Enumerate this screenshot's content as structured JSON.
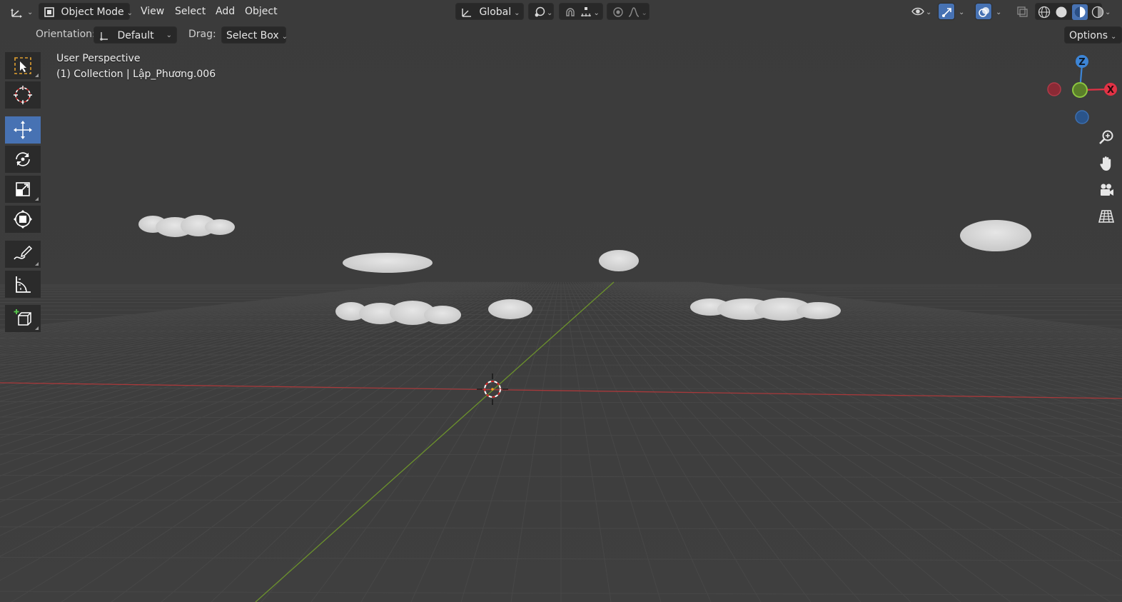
{
  "header": {
    "editor_type_icon": "axes-editor-icon",
    "mode": {
      "icon": "object-mode-icon",
      "label": "Object Mode"
    },
    "menus": [
      "View",
      "Select",
      "Add",
      "Object"
    ],
    "transform_orientation": {
      "icon": "global-orientation-icon",
      "label": "Global"
    },
    "pivot_icon": "pivot-point-icon",
    "snap_icon": "snap-magnet-icon",
    "snap_target_icon": "snap-increment-icon",
    "proportional_icon": "proportional-editing-icon",
    "falloff_icon": "falloff-curve-icon",
    "right_icons": [
      "visibility-eye-icon",
      "gizmo-icon",
      "overlay-icon",
      "xray-icon",
      "wireframe-shading-icon",
      "solid-shading-icon",
      "material-shading-icon",
      "rendered-shading-icon"
    ]
  },
  "tool_settings": {
    "orientation_label": "Orientation:",
    "orientation_value": "Default",
    "drag_label": "Drag:",
    "drag_value": "Select Box",
    "options_label": "Options"
  },
  "toolbar": {
    "tools": [
      "select-box-icon",
      "cursor-icon",
      "move-icon",
      "rotate-icon",
      "scale-icon",
      "transform-icon",
      "annotate-icon",
      "measure-icon",
      "add-cube-icon"
    ],
    "active_tool": "move-icon"
  },
  "viewport": {
    "view_name": "User Perspective",
    "collection_info": "(1) Collection | Lập_Phương.006"
  },
  "gizmo": {
    "axes": [
      "Z",
      "X"
    ],
    "colors": {
      "x": "#e23245",
      "y": "#8cc63f",
      "z": "#3d85d6"
    }
  },
  "nav_buttons": [
    "zoom-icon",
    "hand-pan-icon",
    "camera-icon",
    "grid-ortho-icon"
  ],
  "colors": {
    "background": "#3d3d3d",
    "active_blue": "#4772b3",
    "x_axis_line": "#b03a3a",
    "y_axis_line": "#6b8e2a",
    "cloud": "#dcdcdc"
  }
}
